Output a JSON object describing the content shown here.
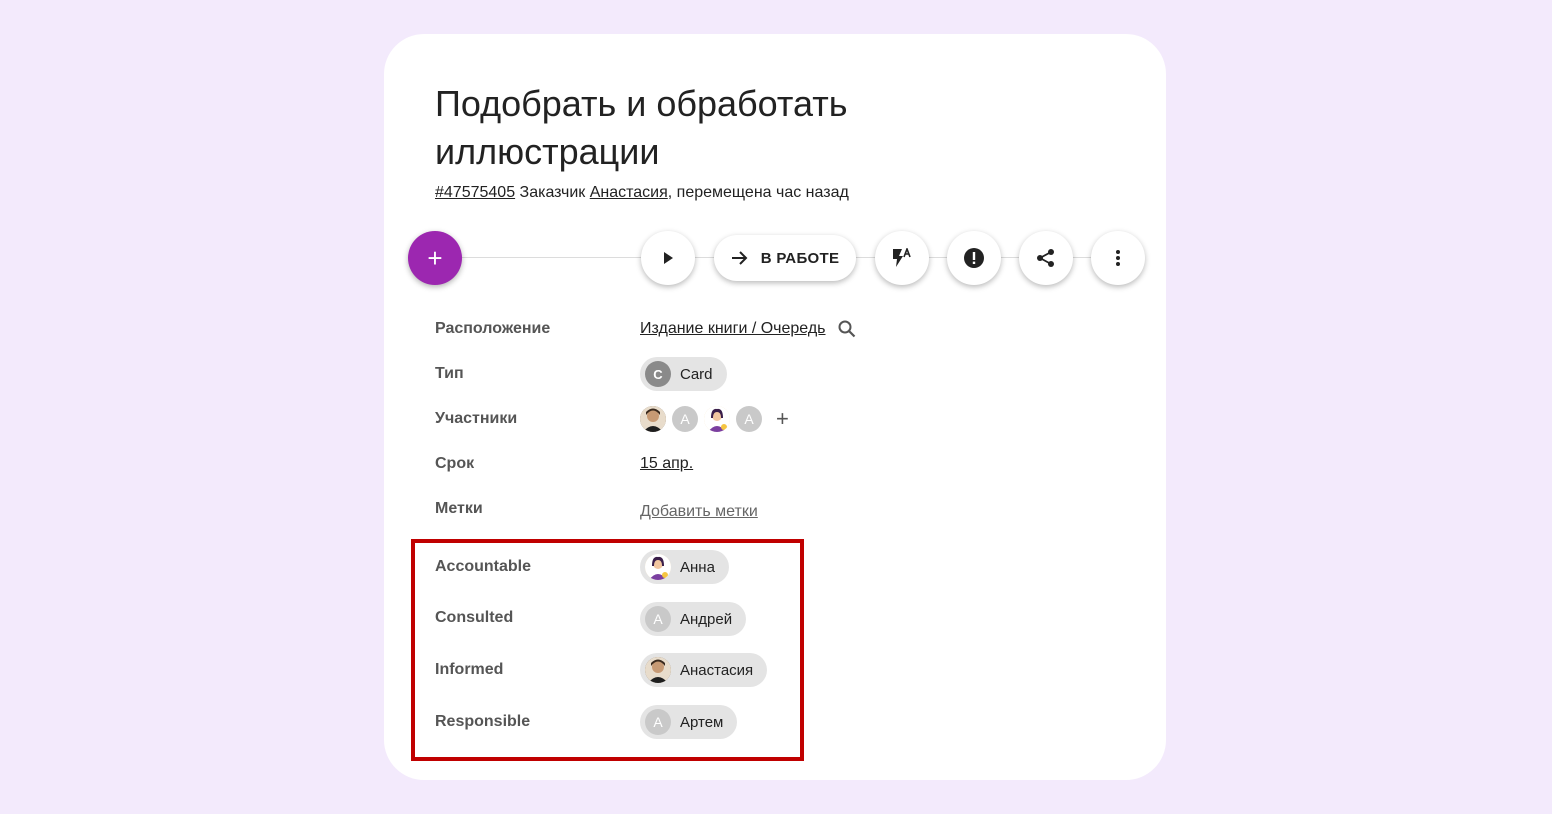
{
  "task": {
    "title": "Подобрать и обработать иллюстрации",
    "id": "#47575405",
    "customer_label": "Заказчик",
    "customer_name": "Анастасия",
    "moved_text": ", перемещена час назад"
  },
  "toolbar": {
    "add_label": "+",
    "status_label": "В РАБОТЕ"
  },
  "properties": {
    "location_label": "Расположение",
    "location_value": "Издание книги / Очередь",
    "type_label": "Тип",
    "type_letter": "C",
    "type_value": "Card",
    "members_label": "Участники",
    "members_letter_1": "A",
    "members_letter_2": "A",
    "members_add": "+",
    "due_label": "Срок",
    "due_value": "15 апр.",
    "tags_label": "Метки",
    "tags_add": "Добавить метки"
  },
  "raci": [
    {
      "label": "Accountable",
      "person": "Анна",
      "avatar": "photo-girl"
    },
    {
      "label": "Consulted",
      "person": "Андрей",
      "avatar": "letter",
      "letter": "A"
    },
    {
      "label": "Informed",
      "person": "Анастасия",
      "avatar": "photo-boy"
    },
    {
      "label": "Responsible",
      "person": "Артем",
      "avatar": "letter",
      "letter": "A"
    }
  ],
  "colors": {
    "background": "#f3eafc",
    "accent": "#9c27b0",
    "highlight": "#c00000"
  }
}
